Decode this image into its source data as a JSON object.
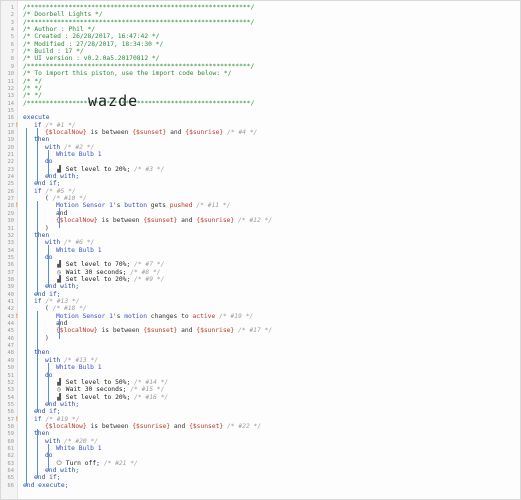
{
  "logo_text": "wazde",
  "lines": [
    {
      "n": "1",
      "t": [
        {
          "c": "cm",
          "v": "/***********************************************************/"
        }
      ]
    },
    {
      "n": "2",
      "t": [
        {
          "c": "cm",
          "v": "/* Doorbell Lights                                        */"
        }
      ]
    },
    {
      "n": "3",
      "t": [
        {
          "c": "cm",
          "v": "/***********************************************************/"
        }
      ]
    },
    {
      "n": "4",
      "t": [
        {
          "c": "cm",
          "v": "/* Author      : Phil                                     */"
        }
      ]
    },
    {
      "n": "5",
      "t": [
        {
          "c": "cm",
          "v": "/* Created     : 26/28/2017, 16:47:42                     */"
        }
      ]
    },
    {
      "n": "6",
      "t": [
        {
          "c": "cm",
          "v": "/* Modified    : 27/28/2017, 18:34:30                     */"
        }
      ]
    },
    {
      "n": "7",
      "t": [
        {
          "c": "cm",
          "v": "/* Build       : 17                                       */"
        }
      ]
    },
    {
      "n": "8",
      "t": [
        {
          "c": "cm",
          "v": "/* UI version  : v0.2.0a5.20170812                        */"
        }
      ]
    },
    {
      "n": "9",
      "t": [
        {
          "c": "cm",
          "v": "/***********************************************************/"
        }
      ]
    },
    {
      "n": "10",
      "t": [
        {
          "c": "cm",
          "v": "/* To import this piston, use the import code below:      */"
        }
      ]
    },
    {
      "n": "11",
      "t": [
        {
          "c": "cm",
          "v": "/*                                                         */"
        }
      ]
    },
    {
      "n": "12",
      "t": [
        {
          "c": "cm",
          "v": "/*                                                         */"
        }
      ]
    },
    {
      "n": "13",
      "t": [
        {
          "c": "cm",
          "v": "/*                                                         */"
        }
      ]
    },
    {
      "n": "14",
      "t": [
        {
          "c": "cm",
          "v": "/***********************************************************/"
        }
      ]
    },
    {
      "n": "15",
      "t": []
    },
    {
      "n": "16",
      "t": [
        {
          "c": "kw",
          "v": "execute"
        }
      ]
    },
    {
      "n": "17",
      "m": true,
      "i": 1,
      "t": [
        {
          "c": "kw",
          "v": "if "
        },
        {
          "c": "id",
          "v": "/* #1 */"
        }
      ]
    },
    {
      "n": "18",
      "i": 2,
      "t": [
        {
          "c": "var",
          "v": "{$localNow}"
        },
        {
          "c": "op",
          "v": " is between "
        },
        {
          "c": "var",
          "v": "{$sunset}"
        },
        {
          "c": "op",
          "v": " and "
        },
        {
          "c": "var",
          "v": "{$sunrise}"
        },
        {
          "c": "id",
          "v": " /* #4 */"
        }
      ]
    },
    {
      "n": "19",
      "i": 1,
      "t": [
        {
          "c": "kw",
          "v": "then"
        }
      ]
    },
    {
      "n": "20",
      "i": 2,
      "t": [
        {
          "c": "kw",
          "v": "with "
        },
        {
          "c": "id",
          "v": "/* #2 */"
        }
      ]
    },
    {
      "n": "21",
      "i": 3,
      "t": [
        {
          "c": "dv",
          "v": "White Bulb 1"
        }
      ]
    },
    {
      "n": "22",
      "i": 2,
      "t": [
        {
          "c": "kw",
          "v": "do"
        }
      ]
    },
    {
      "n": "23",
      "i": 3,
      "t": [
        {
          "c": "gl",
          "v": "▟"
        },
        {
          "c": "cmd",
          "v": " Set level to 20%;"
        },
        {
          "c": "id",
          "v": " /* #3 */"
        }
      ]
    },
    {
      "n": "24",
      "i": 2,
      "t": [
        {
          "c": "kw",
          "v": "end with;"
        }
      ]
    },
    {
      "n": "25",
      "i": 1,
      "t": [
        {
          "c": "kw",
          "v": "end if;"
        }
      ]
    },
    {
      "n": "26",
      "i": 1,
      "t": [
        {
          "c": "kw",
          "v": "if "
        },
        {
          "c": "id",
          "v": "/* #5 */"
        }
      ]
    },
    {
      "n": "27",
      "i": 2,
      "t": [
        {
          "c": "op",
          "v": "( "
        },
        {
          "c": "id",
          "v": "/* #10 */"
        }
      ]
    },
    {
      "n": "28",
      "m": true,
      "i": 3,
      "t": [
        {
          "c": "dv",
          "v": "Motion Sensor 1"
        },
        {
          "c": "op",
          "v": "'s "
        },
        {
          "c": "dv",
          "v": "button"
        },
        {
          "c": "op",
          "v": " gets "
        },
        {
          "c": "var",
          "v": "pushed"
        },
        {
          "c": "id",
          "v": " /* #11 */"
        }
      ]
    },
    {
      "n": "29",
      "i": 3,
      "t": [
        {
          "c": "op",
          "v": "and"
        }
      ]
    },
    {
      "n": "30",
      "i": 3,
      "t": [
        {
          "c": "var",
          "v": "{$localNow}"
        },
        {
          "c": "op",
          "v": " is between "
        },
        {
          "c": "var",
          "v": "{$sunset}"
        },
        {
          "c": "op",
          "v": " and "
        },
        {
          "c": "var",
          "v": "{$sunrise}"
        },
        {
          "c": "id",
          "v": " /* #12 */"
        }
      ]
    },
    {
      "n": "31",
      "i": 2,
      "t": [
        {
          "c": "op",
          "v": ")"
        }
      ]
    },
    {
      "n": "32",
      "i": 1,
      "t": [
        {
          "c": "kw",
          "v": "then"
        }
      ]
    },
    {
      "n": "33",
      "i": 2,
      "t": [
        {
          "c": "kw",
          "v": "with "
        },
        {
          "c": "id",
          "v": "/* #6 */"
        }
      ]
    },
    {
      "n": "34",
      "i": 3,
      "t": [
        {
          "c": "dv",
          "v": "White Bulb 1"
        }
      ]
    },
    {
      "n": "35",
      "i": 2,
      "t": [
        {
          "c": "kw",
          "v": "do"
        }
      ]
    },
    {
      "n": "36",
      "i": 3,
      "t": [
        {
          "c": "gl",
          "v": "▟"
        },
        {
          "c": "cmd",
          "v": " Set level to 70%;"
        },
        {
          "c": "id",
          "v": " /* #7 */"
        }
      ]
    },
    {
      "n": "37",
      "i": 3,
      "t": [
        {
          "c": "gl",
          "v": "◷"
        },
        {
          "c": "cmd",
          "v": " Wait 30 seconds;"
        },
        {
          "c": "id",
          "v": " /* #8 */"
        }
      ]
    },
    {
      "n": "38",
      "i": 3,
      "t": [
        {
          "c": "gl",
          "v": "▟"
        },
        {
          "c": "cmd",
          "v": " Set level to 20%;"
        },
        {
          "c": "id",
          "v": " /* #9 */"
        }
      ]
    },
    {
      "n": "39",
      "i": 2,
      "t": [
        {
          "c": "kw",
          "v": "end with;"
        }
      ]
    },
    {
      "n": "40",
      "i": 1,
      "t": [
        {
          "c": "kw",
          "v": "end if;"
        }
      ]
    },
    {
      "n": "41",
      "i": 1,
      "t": [
        {
          "c": "kw",
          "v": "if "
        },
        {
          "c": "id",
          "v": "/* #13 */"
        }
      ]
    },
    {
      "n": "42",
      "i": 2,
      "t": [
        {
          "c": "op",
          "v": "( "
        },
        {
          "c": "id",
          "v": "/* #18 */"
        }
      ]
    },
    {
      "n": "43",
      "m": true,
      "i": 3,
      "t": [
        {
          "c": "dv",
          "v": "Motion Sensor 1"
        },
        {
          "c": "op",
          "v": "'s "
        },
        {
          "c": "dv",
          "v": "motion"
        },
        {
          "c": "op",
          "v": " changes to "
        },
        {
          "c": "var",
          "v": "active"
        },
        {
          "c": "id",
          "v": " /* #19 */"
        }
      ]
    },
    {
      "n": "44",
      "i": 3,
      "t": [
        {
          "c": "op",
          "v": "and"
        }
      ]
    },
    {
      "n": "45",
      "i": 3,
      "t": [
        {
          "c": "var",
          "v": "{$localNow}"
        },
        {
          "c": "op",
          "v": " is between "
        },
        {
          "c": "var",
          "v": "{$sunset}"
        },
        {
          "c": "op",
          "v": " and "
        },
        {
          "c": "var",
          "v": "{$sunrise}"
        },
        {
          "c": "id",
          "v": " /* #17 */"
        }
      ]
    },
    {
      "n": "46",
      "i": 2,
      "t": [
        {
          "c": "op",
          "v": ")"
        }
      ]
    },
    {
      "n": "47",
      "t": []
    },
    {
      "n": "48",
      "i": 1,
      "t": [
        {
          "c": "kw",
          "v": "then"
        }
      ]
    },
    {
      "n": "49",
      "i": 2,
      "t": [
        {
          "c": "kw",
          "v": "with "
        },
        {
          "c": "id",
          "v": "/* #13 */"
        }
      ]
    },
    {
      "n": "50",
      "i": 3,
      "t": [
        {
          "c": "dv",
          "v": "White Bulb 1"
        }
      ]
    },
    {
      "n": "51",
      "i": 2,
      "t": [
        {
          "c": "kw",
          "v": "do"
        }
      ]
    },
    {
      "n": "52",
      "i": 3,
      "t": [
        {
          "c": "gl",
          "v": "▟"
        },
        {
          "c": "cmd",
          "v": " Set level to 50%;"
        },
        {
          "c": "id",
          "v": " /* #14 */"
        }
      ]
    },
    {
      "n": "53",
      "i": 3,
      "t": [
        {
          "c": "gl",
          "v": "◷"
        },
        {
          "c": "cmd",
          "v": " Wait 30 seconds;"
        },
        {
          "c": "id",
          "v": " /* #15 */"
        }
      ]
    },
    {
      "n": "54",
      "i": 3,
      "t": [
        {
          "c": "gl",
          "v": "▟"
        },
        {
          "c": "cmd",
          "v": " Set level to 20%;"
        },
        {
          "c": "id",
          "v": " /* #16 */"
        }
      ]
    },
    {
      "n": "55",
      "i": 2,
      "t": [
        {
          "c": "kw",
          "v": "end with;"
        }
      ]
    },
    {
      "n": "56",
      "i": 1,
      "t": [
        {
          "c": "kw",
          "v": "end if;"
        }
      ]
    },
    {
      "n": "57",
      "m": true,
      "i": 1,
      "t": [
        {
          "c": "kw",
          "v": "if "
        },
        {
          "c": "id",
          "v": "/* #19 */"
        }
      ]
    },
    {
      "n": "58",
      "i": 2,
      "t": [
        {
          "c": "var",
          "v": "{$localNow}"
        },
        {
          "c": "op",
          "v": " is between "
        },
        {
          "c": "var",
          "v": "{$sunrise}"
        },
        {
          "c": "op",
          "v": " and "
        },
        {
          "c": "var",
          "v": "{$sunset}"
        },
        {
          "c": "id",
          "v": " /* #22 */"
        }
      ]
    },
    {
      "n": "59",
      "i": 1,
      "t": [
        {
          "c": "kw",
          "v": "then"
        }
      ]
    },
    {
      "n": "60",
      "i": 2,
      "t": [
        {
          "c": "kw",
          "v": "with "
        },
        {
          "c": "id",
          "v": "/* #20 */"
        }
      ]
    },
    {
      "n": "61",
      "i": 3,
      "t": [
        {
          "c": "dv",
          "v": "White Bulb 1"
        }
      ]
    },
    {
      "n": "62",
      "i": 2,
      "t": [
        {
          "c": "kw",
          "v": "do"
        }
      ]
    },
    {
      "n": "63",
      "i": 3,
      "t": [
        {
          "c": "gl",
          "v": "⏻"
        },
        {
          "c": "cmd",
          "v": " Turn off;"
        },
        {
          "c": "id",
          "v": " /* #21 */"
        }
      ]
    },
    {
      "n": "64",
      "i": 2,
      "t": [
        {
          "c": "kw",
          "v": "end with;"
        }
      ]
    },
    {
      "n": "65",
      "i": 1,
      "t": [
        {
          "c": "kw",
          "v": "end if;"
        }
      ]
    },
    {
      "n": "66",
      "t": [
        {
          "c": "kw",
          "v": "end execute;"
        }
      ]
    }
  ]
}
